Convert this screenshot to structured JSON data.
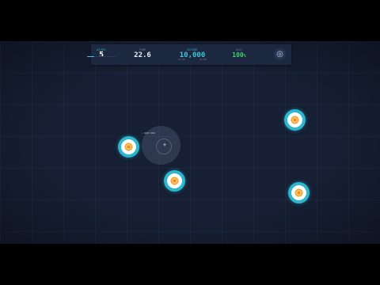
{
  "hud": {
    "level": {
      "label": "LEVEL",
      "value": "5"
    },
    "time": {
      "label": "TIME",
      "value": "22.6"
    },
    "score": {
      "label": "SCORE",
      "value": "10,000",
      "progress": 0.25,
      "sub_left": "12,345",
      "sub_right": "40,000"
    },
    "accuracy": {
      "label": "ACC",
      "value": "100",
      "unit": "%"
    },
    "settings_icon": "target-settings-icon",
    "settings_glyph": "◎"
  },
  "cursor": {
    "label": "• 000 000",
    "crosshair_glyph": "+"
  },
  "targets": [
    {
      "name": "target-1"
    },
    {
      "name": "target-2"
    },
    {
      "name": "target-3"
    },
    {
      "name": "target-4"
    },
    {
      "name": "target-5"
    }
  ],
  "colors": {
    "background": "#161f33",
    "hud_panel": "#1c2740",
    "accent_cyan": "#3ec4d8",
    "accuracy_green": "#43d16a",
    "target_ring": "#2bb7d0",
    "target_center": "#f28a1e"
  }
}
